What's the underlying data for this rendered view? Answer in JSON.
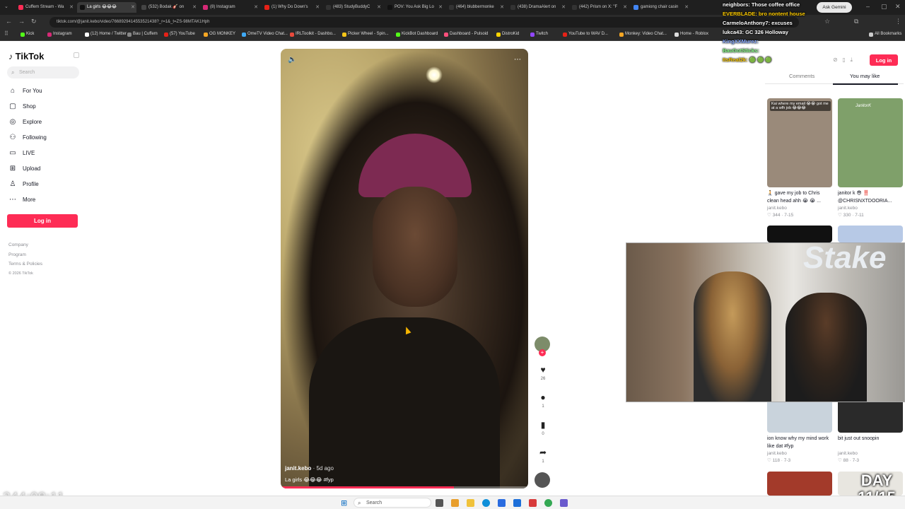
{
  "browser": {
    "tabs": [
      {
        "title": "Cuffem Stream - Wa",
        "color": "#fe2c55"
      },
      {
        "title": "La girls 😂😂😂",
        "color": "#111111",
        "active": true
      },
      {
        "title": "(532) Bodak 🎸 on",
        "color": "#444444"
      },
      {
        "title": "(8) Instagram",
        "color": "#d62976"
      },
      {
        "title": "(1) Why Do Down's",
        "color": "#e62117"
      },
      {
        "title": "(483) StudyBuddyC",
        "color": "#333333"
      },
      {
        "title": "POV: You Ask Big Lo",
        "color": "#111111"
      },
      {
        "title": "(464) blubbermonke",
        "color": "#333333"
      },
      {
        "title": "(438) DramaAlert on",
        "color": "#333333"
      },
      {
        "title": "(442) Prism on X: \"F",
        "color": "#333333"
      },
      {
        "title": "gamiong chair casin",
        "color": "#4285f4"
      }
    ],
    "ask_gemini": "Ask Gemini",
    "url": "tiktok.com/@janit.kebo/video/7668929414553521438?_r=1&_t=ZS-98MTAK1Hph",
    "bookmarks": [
      {
        "label": "Kick",
        "color": "#53fc18"
      },
      {
        "label": "Instagram",
        "color": "#d62976"
      },
      {
        "label": "(12) Home / Twitter",
        "color": "#ffffff"
      },
      {
        "label": "Bau | Cuffem",
        "color": "#888888"
      },
      {
        "label": "(57) YouTube",
        "color": "#e62117"
      },
      {
        "label": "OG MONKEY",
        "color": "#f5a623"
      },
      {
        "label": "OmeTV Video Chat...",
        "color": "#3fa9f5"
      },
      {
        "label": "IRLToolkit - Dashbo...",
        "color": "#e84a3c"
      },
      {
        "label": "Picker Wheel - Spin...",
        "color": "#f5c518"
      },
      {
        "label": "KickBot Dashboard",
        "color": "#53fc18"
      },
      {
        "label": "Dashboard - Pulsoid",
        "color": "#ff4f7b"
      },
      {
        "label": "DistroKid",
        "color": "#ffd400"
      },
      {
        "label": "Twitch",
        "color": "#9146ff"
      },
      {
        "label": "YouTube to WAV D...",
        "color": "#e62117"
      },
      {
        "label": "Monkey: Video Chat...",
        "color": "#f5a623"
      },
      {
        "label": "Home - Roblox",
        "color": "#dddddd"
      },
      {
        "label": "All Bookmarks",
        "color": "#cccccc"
      }
    ]
  },
  "tiktok": {
    "logo": "TikTok",
    "search_placeholder": "Search",
    "nav": [
      {
        "label": "For You",
        "icon": "home-icon",
        "glyph": "⌂"
      },
      {
        "label": "Shop",
        "icon": "shop-icon",
        "glyph": "▢"
      },
      {
        "label": "Explore",
        "icon": "explore-icon",
        "glyph": "◎"
      },
      {
        "label": "Following",
        "icon": "following-icon",
        "glyph": "⚇"
      },
      {
        "label": "LIVE",
        "icon": "live-icon",
        "glyph": "▭"
      },
      {
        "label": "Upload",
        "icon": "upload-icon",
        "glyph": "⊞"
      },
      {
        "label": "Profile",
        "icon": "profile-icon",
        "glyph": "♙"
      },
      {
        "label": "More",
        "icon": "more-icon",
        "glyph": "⋯"
      }
    ],
    "login_label": "Log in",
    "footer": [
      "Company",
      "Program",
      "Terms & Policies",
      "© 2026 TikTok"
    ],
    "video": {
      "username": "janit.kebo",
      "ago": "· 5d ago",
      "description": "La girls 😂😂😂 #fyp"
    },
    "actions": [
      {
        "icon": "heart-icon",
        "glyph": "♥",
        "count": "26"
      },
      {
        "icon": "comment-icon",
        "glyph": "●",
        "count": "1"
      },
      {
        "icon": "bookmark-icon",
        "glyph": "▮",
        "count": "0"
      },
      {
        "icon": "share-icon",
        "glyph": "➦",
        "count": "1"
      }
    ],
    "right_tabs": {
      "comments": "Comments",
      "you_may_like": "You may like"
    },
    "cards": [
      {
        "title": "🧎 gave my job to Chris clean head ahh 😭 😭 ...",
        "user": "janit.kebo",
        "stat": "♡ 344 · 7-15",
        "color": "#9a8a7a"
      },
      {
        "title": "janitor k 😎 ‼️ @CHRISNXTDOORIA...",
        "user": "janit.kebo",
        "stat": "♡ 330 · 7-11",
        "color": "#7fa06a"
      },
      {
        "title": "ion know why my mind work like dat #fyp",
        "user": "janit.kebo",
        "stat": "♡ 118 · 7-3",
        "color": "#c9d3dc"
      },
      {
        "title": "bit just out snoopin",
        "user": "janit.kebo",
        "stat": "♡ 88 · 7-3",
        "color": "#2a2a2a"
      }
    ],
    "card_thumb_texts": [
      "Kai where my email 😭😭 got me at a wfh job 😂😂😂",
      "JanitorK"
    ]
  },
  "chat": [
    {
      "text": "neighbors: Those coffee office",
      "color": "#ffffff"
    },
    {
      "text": "EVERBLADE: bro nontent house",
      "color": "#ffcc00"
    },
    {
      "text": "CarmeloAnthony7: excuses",
      "color": "#ffffff"
    },
    {
      "text": "lukca43: GC 326 Holloway",
      "color": "#ffffff"
    },
    {
      "text": "KingXXMurez:",
      "color": "#88aaff"
    },
    {
      "text": "BauGotSticks:",
      "color": "#88ff88"
    },
    {
      "text": "ItsReal2k: 🟢 🟢 🟢",
      "color": "#ffcc00"
    }
  ],
  "overlay": {
    "timer": "244:08:11",
    "day": "DAY 11/15",
    "webcam_brand": "Stake"
  },
  "taskbar": {
    "search_placeholder": "Search"
  }
}
